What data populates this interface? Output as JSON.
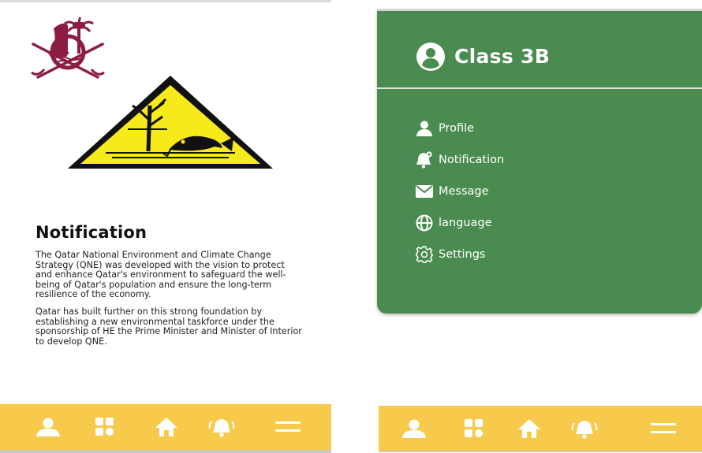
{
  "colors": {
    "drawer_green": "#4a8c50",
    "bottom_bar_yellow": "#f8ca4c",
    "emblem_maroon": "#8c1d40",
    "hazard_yellow": "#f7ea1a"
  },
  "notification_screen": {
    "title": "Notification",
    "paragraphs": [
      "The Qatar National Environment and Climate Change Strategy (QNE) was developed with the vision to protect and enhance Qatar's environment to safeguard the well-being of Qatar's population and ensure the long-term resilience of the economy.",
      "Qatar has built further on this strong foundation by establishing a new environmental taskforce under the sponsorship of HE the Prime Minister and Minister of Interior to develop QNE."
    ]
  },
  "drawer": {
    "title": "Class 3B",
    "items": [
      {
        "label": "Profile",
        "icon": "person-icon"
      },
      {
        "label": "Notification",
        "icon": "bell-icon"
      },
      {
        "label": "Message",
        "icon": "envelope-icon"
      },
      {
        "label": "language",
        "icon": "globe-icon"
      },
      {
        "label": "Settings",
        "icon": "gear-icon"
      }
    ]
  },
  "bottom_nav": {
    "icons": [
      "person-icon",
      "grid-icon",
      "home-icon",
      "bell-icon",
      "menu-icon"
    ]
  }
}
